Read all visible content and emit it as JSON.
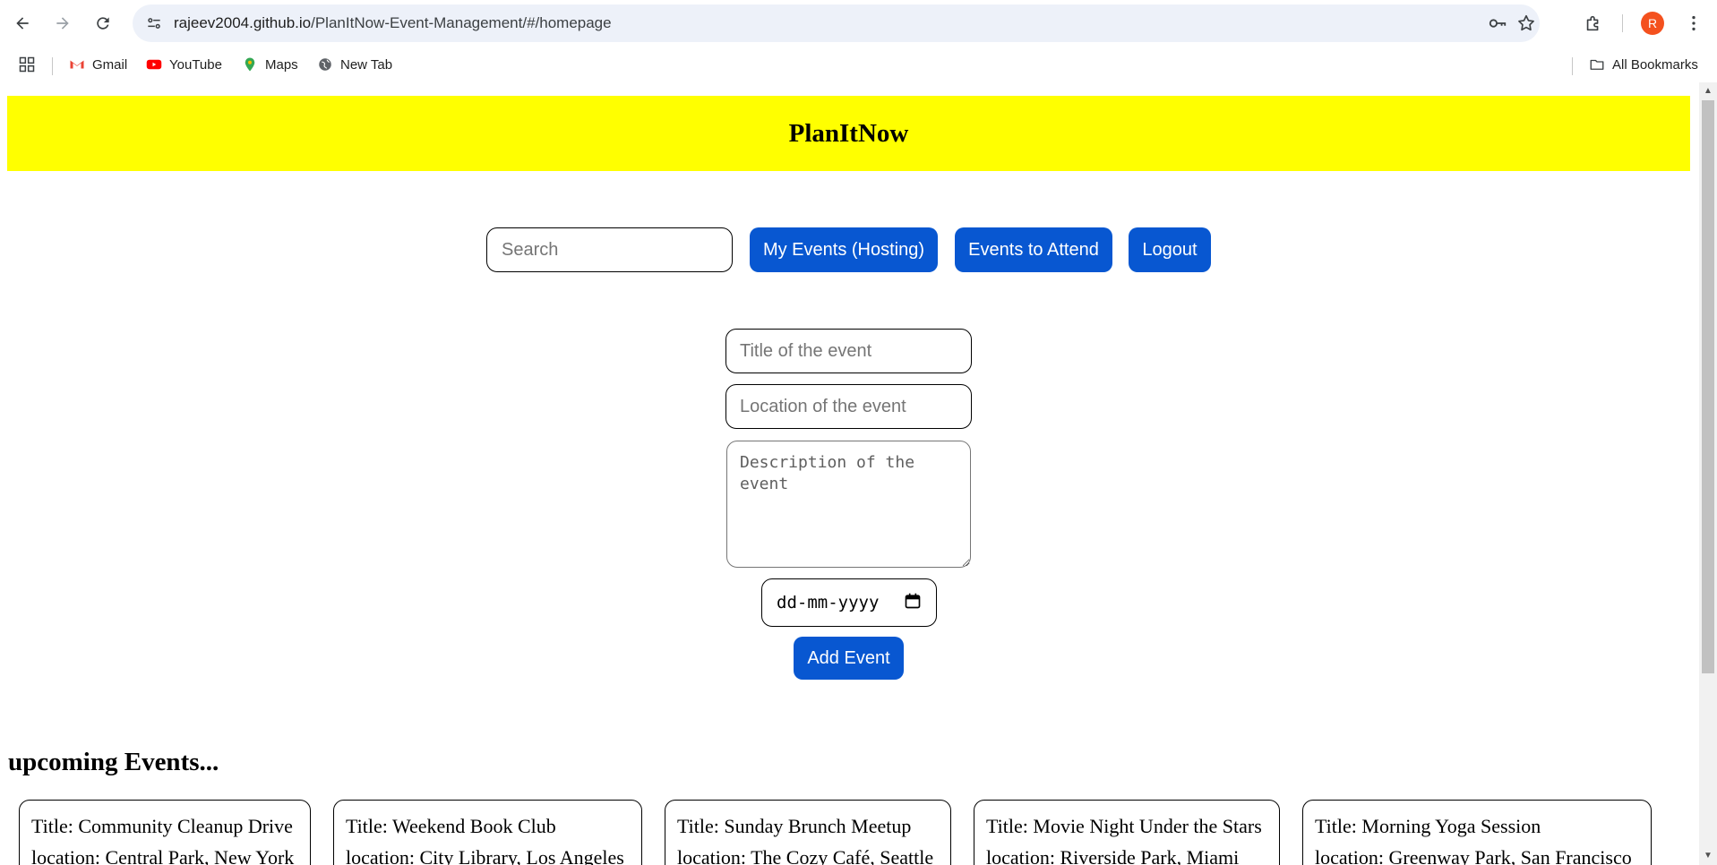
{
  "browser": {
    "url_host": "rajeev2004.github.io",
    "url_path": "/PlanItNow-Event-Management/#/homepage",
    "avatar_letter": "R",
    "bookmarks": [
      {
        "label": "Gmail",
        "icon": "gmail-icon"
      },
      {
        "label": "YouTube",
        "icon": "youtube-icon"
      },
      {
        "label": "Maps",
        "icon": "maps-icon"
      },
      {
        "label": "New Tab",
        "icon": "globe-icon"
      }
    ],
    "all_bookmarks_label": "All Bookmarks"
  },
  "app": {
    "title": "PlanItNow",
    "header_color": "#ffff00",
    "accent_color": "#0857d1"
  },
  "toolbar": {
    "search_placeholder": "Search",
    "my_events_label": "My Events (Hosting)",
    "events_to_attend_label": "Events to Attend",
    "logout_label": "Logout"
  },
  "form": {
    "title_placeholder": "Title of the event",
    "location_placeholder": "Location of the event",
    "description_placeholder": "Description of the event",
    "date_placeholder": "dd-mm-yyyy",
    "add_button_label": "Add Event"
  },
  "upcoming": {
    "heading": "upcoming Events...",
    "events": [
      {
        "title": "Title: Community Cleanup Drive",
        "location": "location: Central Park, New York"
      },
      {
        "title": "Title: Weekend Book Club",
        "location": "location: City Library, Los Angeles"
      },
      {
        "title": "Title: Sunday Brunch Meetup",
        "location": "location: The Cozy Café, Seattle"
      },
      {
        "title": "Title: Movie Night Under the Stars",
        "location": "location: Riverside Park, Miami"
      },
      {
        "title": "Title: Morning Yoga Session",
        "location": "location: Greenway Park, San Francisco"
      }
    ]
  }
}
